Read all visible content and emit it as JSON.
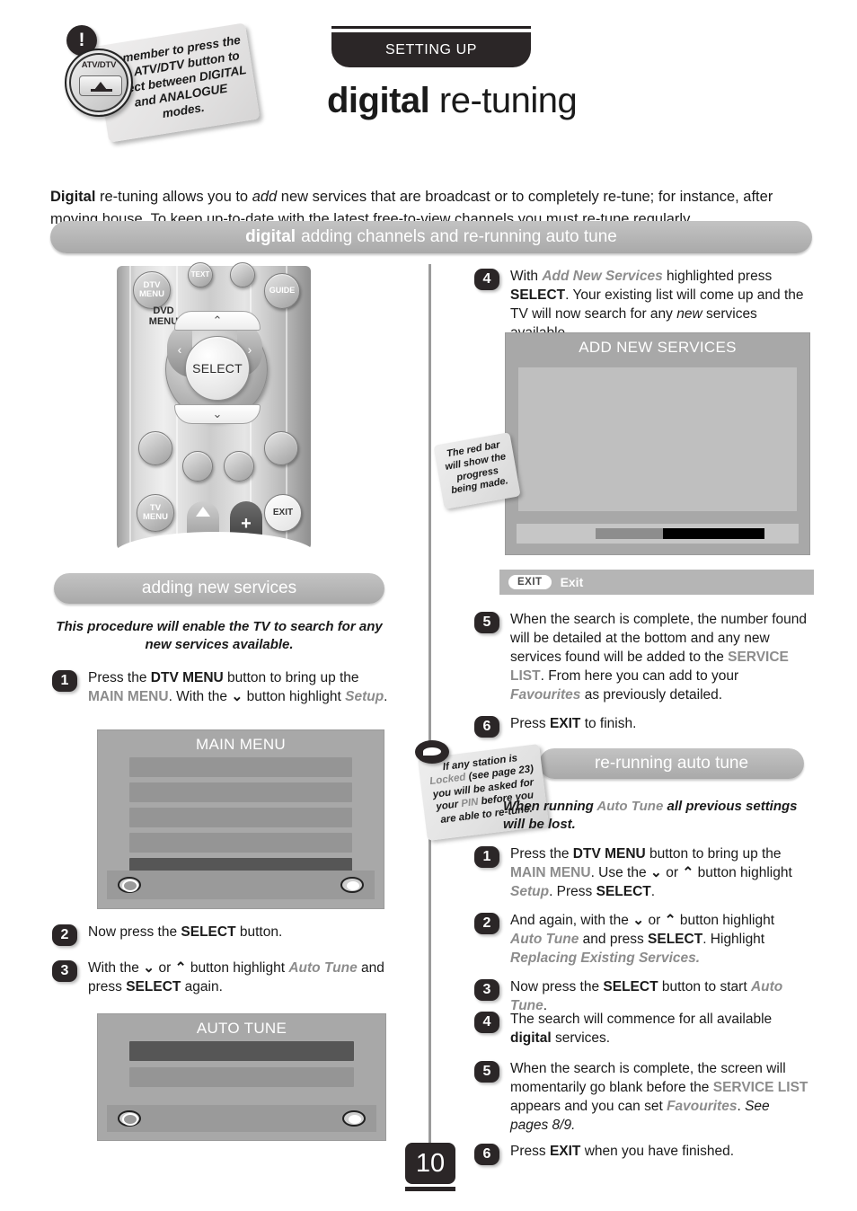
{
  "header": {
    "section_label": "SETTING UP",
    "title_bold": "digital",
    "title_light": " re-tuning"
  },
  "notes": {
    "atv_dtv": {
      "icon": "!",
      "button_label": "ATV/DTV",
      "text": "Remember to press the the ATV/DTV button to select between DIGITAL and ANALOGUE modes."
    },
    "red_bar": {
      "text": "The red bar will show the progress being made."
    },
    "locked": {
      "text_prefix": "If any station is",
      "text_locked": "Locked",
      "text_rest": "(see page 23) you will be asked for your",
      "text_pin": "PIN",
      "text_tail": "before you are able to re-tune."
    }
  },
  "intro": {
    "lead_bold": "Digital",
    "line1_a": " re-tuning allows you to ",
    "line1_em": "add",
    "line1_b": " new services that are broadcast or to completely re-tune; for instance, after moving house. To keep up-to-date with the latest free-to-view channels you must re-tune regularly."
  },
  "banners": {
    "main_bold": "digital",
    "main_light": "adding channels and re-running auto tune",
    "adding_new_services": "adding new services",
    "re_running_auto_tune": "re-running auto tune"
  },
  "remote": {
    "dtv_menu": "DTV MENU",
    "dvd_menu": "DVD MENU",
    "guide": "GUIDE",
    "text": "TEXT",
    "select": "SELECT",
    "tv_menu": "TV MENU",
    "exit": "EXIT",
    "up": "⌃",
    "down": "⌄",
    "left": "‹",
    "right": "›",
    "plus": "+"
  },
  "left_column": {
    "subhead": "This procedure will enable the TV to search for any new services available.",
    "steps": [
      {
        "num": "1",
        "parts": [
          {
            "t": "Press the ",
            "s": "n"
          },
          {
            "t": "DTV MENU",
            "s": "b"
          },
          {
            "t": " button to bring up the ",
            "s": "n"
          },
          {
            "t": "MAIN MENU",
            "s": "g"
          },
          {
            "t": ". With the ",
            "s": "n"
          },
          {
            "t": "⌄",
            "s": "arrow"
          },
          {
            "t": " button highlight ",
            "s": "n"
          },
          {
            "t": "Setup",
            "s": "gi"
          },
          {
            "t": ".",
            "s": "n"
          }
        ]
      },
      {
        "num": "2",
        "parts": [
          {
            "t": "Now press the ",
            "s": "n"
          },
          {
            "t": "SELECT",
            "s": "b"
          },
          {
            "t": " button.",
            "s": "n"
          }
        ]
      },
      {
        "num": "3",
        "parts": [
          {
            "t": "With the ",
            "s": "n"
          },
          {
            "t": "⌄",
            "s": "arrow"
          },
          {
            "t": " or ",
            "s": "n"
          },
          {
            "t": "⌃",
            "s": "arrow"
          },
          {
            "t": " button highlight ",
            "s": "n"
          },
          {
            "t": "Auto Tune",
            "s": "gi"
          },
          {
            "t": " and press ",
            "s": "n"
          },
          {
            "t": "SELECT",
            "s": "b"
          },
          {
            "t": " again.",
            "s": "n"
          }
        ]
      }
    ]
  },
  "right_column": {
    "steps_add": [
      {
        "num": "4",
        "parts": [
          {
            "t": "With ",
            "s": "n"
          },
          {
            "t": "Add New Services",
            "s": "gi"
          },
          {
            "t": " highlighted press ",
            "s": "n"
          },
          {
            "t": "SELECT",
            "s": "b"
          },
          {
            "t": ". Your existing list will come up and the TV will now search for any ",
            "s": "n"
          },
          {
            "t": "new",
            "s": "i"
          },
          {
            "t": " services available.",
            "s": "n"
          }
        ]
      },
      {
        "num": "5",
        "parts": [
          {
            "t": "When the search is complete, the number found will be detailed at the bottom and any new services found will be added to the ",
            "s": "n"
          },
          {
            "t": "SERVICE LIST",
            "s": "g"
          },
          {
            "t": ". From here you can add to your ",
            "s": "n"
          },
          {
            "t": "Favourites",
            "s": "gi"
          },
          {
            "t": " as previously detailed.",
            "s": "n"
          }
        ]
      },
      {
        "num": "6",
        "parts": [
          {
            "t": "Press ",
            "s": "n"
          },
          {
            "t": "EXIT",
            "s": "b"
          },
          {
            "t": " to finish.",
            "s": "n"
          }
        ]
      }
    ],
    "subhead_parts": [
      {
        "t": "When running ",
        "s": "n"
      },
      {
        "t": "Auto Tune",
        "s": "g"
      },
      {
        "t": " all previous settings will be lost.",
        "s": "n"
      }
    ],
    "steps_retune": [
      {
        "num": "1",
        "parts": [
          {
            "t": "Press the ",
            "s": "n"
          },
          {
            "t": "DTV MENU",
            "s": "b"
          },
          {
            "t": " button to bring up the ",
            "s": "n"
          },
          {
            "t": "MAIN MENU",
            "s": "g"
          },
          {
            "t": ". Use the ",
            "s": "n"
          },
          {
            "t": "⌄",
            "s": "arrow"
          },
          {
            "t": " or ",
            "s": "n"
          },
          {
            "t": "⌃",
            "s": "arrow"
          },
          {
            "t": " button highlight ",
            "s": "n"
          },
          {
            "t": "Setup",
            "s": "gi"
          },
          {
            "t": ". Press ",
            "s": "n"
          },
          {
            "t": "SELECT",
            "s": "b"
          },
          {
            "t": ".",
            "s": "n"
          }
        ]
      },
      {
        "num": "2",
        "parts": [
          {
            "t": "And again, with the ",
            "s": "n"
          },
          {
            "t": "⌄",
            "s": "arrow"
          },
          {
            "t": " or ",
            "s": "n"
          },
          {
            "t": "⌃",
            "s": "arrow"
          },
          {
            "t": " button highlight ",
            "s": "n"
          },
          {
            "t": "Auto Tune",
            "s": "gi"
          },
          {
            "t": " and press ",
            "s": "n"
          },
          {
            "t": "SELECT",
            "s": "b"
          },
          {
            "t": ". Highlight ",
            "s": "n"
          },
          {
            "t": "Replacing Existing Services.",
            "s": "gi"
          }
        ]
      },
      {
        "num": "3",
        "parts": [
          {
            "t": "Now press the ",
            "s": "n"
          },
          {
            "t": "SELECT",
            "s": "b"
          },
          {
            "t": " button to start ",
            "s": "n"
          },
          {
            "t": "Auto Tune",
            "s": "gi"
          },
          {
            "t": ".",
            "s": "n"
          }
        ]
      },
      {
        "num": "4",
        "parts": [
          {
            "t": "The search will commence for all available ",
            "s": "n"
          },
          {
            "t": "digital",
            "s": "b"
          },
          {
            "t": " services.",
            "s": "n"
          }
        ]
      },
      {
        "num": "5",
        "parts": [
          {
            "t": "When the search is complete, the screen will momentarily go blank before the ",
            "s": "n"
          },
          {
            "t": "SERVICE LIST",
            "s": "g"
          },
          {
            "t": " appears and you can set ",
            "s": "n"
          },
          {
            "t": "Favourites",
            "s": "gi"
          },
          {
            "t": ". ",
            "s": "n"
          },
          {
            "t": "See pages 8/9.",
            "s": "i"
          }
        ]
      },
      {
        "num": "6",
        "parts": [
          {
            "t": "Press ",
            "s": "n"
          },
          {
            "t": "EXIT",
            "s": "b"
          },
          {
            "t": " when you have finished.",
            "s": "n"
          }
        ]
      }
    ]
  },
  "screens": {
    "main_menu": {
      "title": "MAIN MENU",
      "rows": [
        "",
        "",
        "",
        "",
        ""
      ],
      "selected_index": 4
    },
    "auto_tune": {
      "title": "AUTO TUNE",
      "rows": [
        "",
        ""
      ],
      "selected_index": 0
    },
    "add_new_services": {
      "title": "ADD NEW SERVICES",
      "progress_grey_pct": 24,
      "progress_dark_pct": 36
    },
    "exit_bar": {
      "key": "EXIT",
      "label": "Exit"
    }
  },
  "footer": {
    "page_number": "10"
  }
}
